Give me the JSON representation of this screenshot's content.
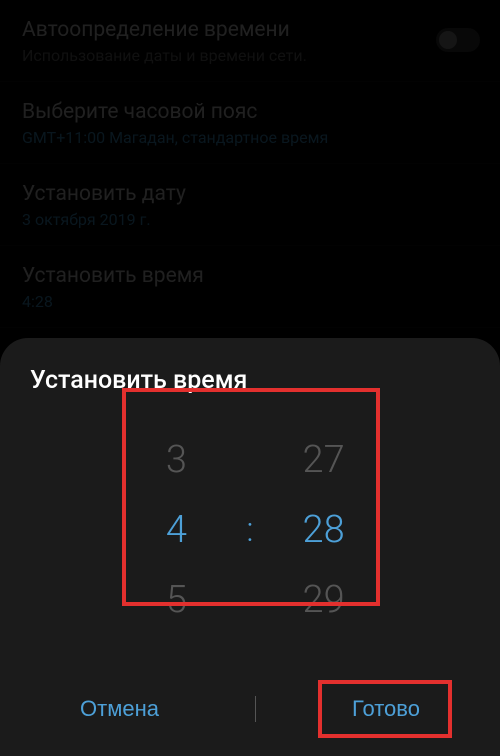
{
  "settings": {
    "auto_time": {
      "title": "Автоопределение времени",
      "sub": "Использование даты и времени сети."
    },
    "timezone": {
      "title": "Выберите часовой пояс",
      "sub": "GMT+11:00 Магадан, стандартное время"
    },
    "date": {
      "title": "Установить дату",
      "sub": "3 октября 2019 г."
    },
    "time": {
      "title": "Установить время",
      "sub": "4:28"
    }
  },
  "dialog": {
    "title": "Установить время",
    "hour_prev": "3",
    "hour": "4",
    "hour_next": "5",
    "minute_prev": "27",
    "minute": "28",
    "minute_next": "29",
    "separator": ":",
    "cancel": "Отмена",
    "done": "Готово"
  }
}
